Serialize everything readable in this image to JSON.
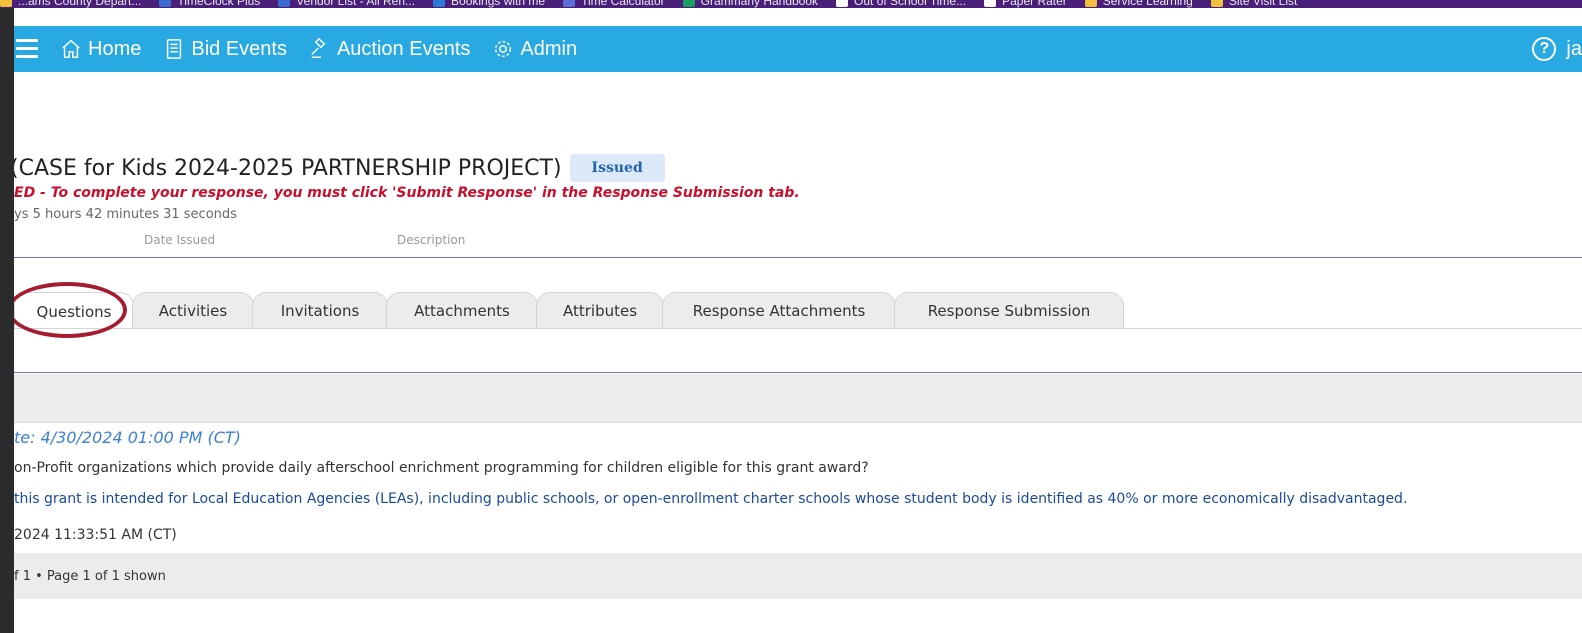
{
  "bookmarks": [
    {
      "label": "...ams County Depart...",
      "icon": "folder-icon",
      "color": "#f0c23b"
    },
    {
      "label": "TimeClock Plus",
      "icon": "tcp-icon",
      "color": "#3b6ad1"
    },
    {
      "label": "Vendor List - All Ren...",
      "icon": "tcp-icon",
      "color": "#3b6ad1"
    },
    {
      "label": "Bookings with me",
      "icon": "calendar-icon",
      "color": "#2a7ad8"
    },
    {
      "label": "Time Calculator",
      "icon": "globe-icon",
      "color": "#5a6fd6"
    },
    {
      "label": "Grammarly Handbook",
      "icon": "grammarly-icon",
      "color": "#1aa061"
    },
    {
      "label": "Out of School Time...",
      "icon": "page-icon",
      "color": "#ffffff"
    },
    {
      "label": "Paper Rater",
      "icon": "page-icon",
      "color": "#ffffff"
    },
    {
      "label": "Service Learning",
      "icon": "folder-icon",
      "color": "#f0c23b"
    },
    {
      "label": "Site Visit List",
      "icon": "folder-icon",
      "color": "#f0c23b"
    }
  ],
  "nav": {
    "home": "Home",
    "bid_events": "Bid Events",
    "auction_events": "Auction Events",
    "admin": "Admin",
    "user": "ja",
    "help": "?"
  },
  "event": {
    "title": "(CASE for Kids 2024-2025 PARTNERSHIP PROJECT)",
    "status": "Issued",
    "notice": "ED - To complete your response, you must click 'Submit Response' in the Response Submission tab.",
    "countdown": "ys 5 hours 42 minutes 31 seconds",
    "label_date_issued": "Date Issued",
    "label_description": "Description"
  },
  "tabs": [
    {
      "label": "Questions",
      "active": true
    },
    {
      "label": "Activities",
      "active": false
    },
    {
      "label": "Invitations",
      "active": false
    },
    {
      "label": "Attachments",
      "active": false
    },
    {
      "label": "Attributes",
      "active": false
    },
    {
      "label": "Response Attachments",
      "active": false
    },
    {
      "label": "Response Submission",
      "active": false
    }
  ],
  "question": {
    "date": "te: 4/30/2024 01:00 PM (CT)",
    "text": "on-Profit organizations which provide daily afterschool enrichment programming for children eligible for this grant award?",
    "answer": "this grant is intended for Local Education Agencies (LEAs), including public schools, or open-enrollment charter schools whose student body is identified as 40% or more economically disadvantaged.",
    "answer_date": "2024 11:33:51 AM (CT)"
  },
  "pager": {
    "text": "f 1 • Page 1 of 1 shown"
  },
  "colors": {
    "navbar": "#29a9e1",
    "bookmarks_bar": "#4a1f7a",
    "notice": "#c8102e",
    "badge_bg": "#dbe9f9",
    "annotation": "#a51c30"
  }
}
